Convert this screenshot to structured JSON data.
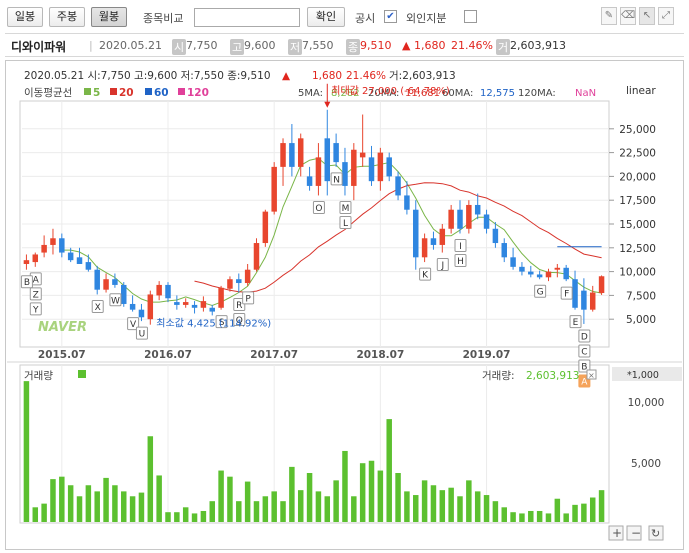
{
  "toolbar": {
    "tab_daily": "일봉",
    "tab_weekly": "주봉",
    "tab_monthly": "월봉",
    "compare_label": "종목비교",
    "compare_value": "",
    "confirm_button": "확인",
    "disclosure_label": "공시",
    "disclosure_checked": "✔",
    "foreign_label": "외인지분"
  },
  "stock": {
    "name": "디와이파워",
    "date": "2020.05.21",
    "open_tag": "시",
    "open": "7,750",
    "high_tag": "고",
    "high": "9,600",
    "low_tag": "저",
    "low": "7,550",
    "close_tag": "종",
    "close": "9,510",
    "change": "▲ 1,680",
    "change_pct": "21.46%",
    "volume_tag": "거",
    "volume": "2,603,913"
  },
  "chart_header": {
    "line": "2020.05.21 시:7,750 고:9,600 저:7,550 종:9,510",
    "up_arrow": "▲",
    "change": "1,680",
    "change_pct": "21.46%",
    "volume": "거:2,603,913"
  },
  "ma_legend": {
    "title": "이동평균선",
    "items": [
      "5",
      "20",
      "60",
      "120"
    ],
    "ma5_label": "5MA:",
    "ma5_value": "8,282",
    "ma20_label": "20MA:",
    "ma20_value": "11,681",
    "ma60_label": "60MA:",
    "ma60_value": "12,575",
    "ma120_label": "120MA:",
    "ma120_value": "NaN",
    "scale_mode": "linear"
  },
  "colors": {
    "up": "#e8462e",
    "down": "#2f86e0",
    "ma5": "#7ab648",
    "ma20": "#d8342c",
    "ma60": "#1f63c6",
    "ma120": "#e0409a",
    "volume": "#5cc02f"
  },
  "annotations": {
    "max_label": "최대값 27,000 (-64.78%)",
    "min_label": "최소값 4,425 (114.92%)"
  },
  "watermark": "NAVER",
  "volume_panel": {
    "title": "거래량",
    "readout_label": "거래량:",
    "readout_value": "2,603,913",
    "unit": "*1,000",
    "ticks": [
      "10,000",
      "5,000"
    ]
  },
  "chart_data": {
    "type": "candlestick",
    "interval": "monthly",
    "y_range": [
      2500,
      27500
    ],
    "y_ticks": [
      "25,000",
      "22,500",
      "20,000",
      "17,500",
      "15,000",
      "12,500",
      "10,000",
      "7,500",
      "5,000"
    ],
    "x_ticks": [
      "2015.07",
      "2016.07",
      "2017.07",
      "2018.07",
      "2019.07"
    ],
    "candles": [
      {
        "o": 10800,
        "h": 11800,
        "l": 10200,
        "c": 11200
      },
      {
        "o": 11000,
        "h": 12000,
        "l": 10500,
        "c": 11800
      },
      {
        "o": 12000,
        "h": 13800,
        "l": 11500,
        "c": 12800
      },
      {
        "o": 12800,
        "h": 14500,
        "l": 11800,
        "c": 13500
      },
      {
        "o": 13500,
        "h": 14000,
        "l": 11500,
        "c": 12000
      },
      {
        "o": 12000,
        "h": 12500,
        "l": 11000,
        "c": 11200
      },
      {
        "o": 11500,
        "h": 12500,
        "l": 10800,
        "c": 10800
      },
      {
        "o": 11000,
        "h": 11800,
        "l": 10000,
        "c": 10200
      },
      {
        "o": 10200,
        "h": 10600,
        "l": 7600,
        "c": 8100
      },
      {
        "o": 8100,
        "h": 9800,
        "l": 7800,
        "c": 9200
      },
      {
        "o": 9200,
        "h": 9800,
        "l": 8300,
        "c": 8600
      },
      {
        "o": 8600,
        "h": 8900,
        "l": 6300,
        "c": 6600
      },
      {
        "o": 6600,
        "h": 7500,
        "l": 5800,
        "c": 6000
      },
      {
        "o": 6000,
        "h": 6600,
        "l": 4800,
        "c": 5200
      },
      {
        "o": 5000,
        "h": 8000,
        "l": 4425,
        "c": 7600
      },
      {
        "o": 7500,
        "h": 9000,
        "l": 7000,
        "c": 8600
      },
      {
        "o": 8600,
        "h": 8900,
        "l": 6800,
        "c": 7200
      },
      {
        "o": 6800,
        "h": 7500,
        "l": 6000,
        "c": 6500
      },
      {
        "o": 6500,
        "h": 7200,
        "l": 6200,
        "c": 6800
      },
      {
        "o": 6500,
        "h": 6900,
        "l": 5600,
        "c": 6200
      },
      {
        "o": 6200,
        "h": 7400,
        "l": 5800,
        "c": 6900
      },
      {
        "o": 6200,
        "h": 6500,
        "l": 5400,
        "c": 5800
      },
      {
        "o": 6200,
        "h": 8500,
        "l": 6000,
        "c": 8300
      },
      {
        "o": 8200,
        "h": 9500,
        "l": 7900,
        "c": 9200
      },
      {
        "o": 9200,
        "h": 9800,
        "l": 7800,
        "c": 8800
      },
      {
        "o": 8800,
        "h": 10800,
        "l": 8500,
        "c": 10200
      },
      {
        "o": 10200,
        "h": 13500,
        "l": 10000,
        "c": 13000
      },
      {
        "o": 13000,
        "h": 16500,
        "l": 12600,
        "c": 16300
      },
      {
        "o": 16300,
        "h": 21500,
        "l": 16000,
        "c": 21000
      },
      {
        "o": 21000,
        "h": 24000,
        "l": 19000,
        "c": 23500
      },
      {
        "o": 23500,
        "h": 25500,
        "l": 20000,
        "c": 21000
      },
      {
        "o": 21000,
        "h": 24500,
        "l": 20000,
        "c": 24000
      },
      {
        "o": 20000,
        "h": 21000,
        "l": 18500,
        "c": 19000
      },
      {
        "o": 19000,
        "h": 23500,
        "l": 18000,
        "c": 22000
      },
      {
        "o": 24000,
        "h": 27000,
        "l": 18000,
        "c": 19500
      },
      {
        "o": 23500,
        "h": 24500,
        "l": 21000,
        "c": 21500
      },
      {
        "o": 21500,
        "h": 23000,
        "l": 18000,
        "c": 19000
      },
      {
        "o": 19000,
        "h": 23500,
        "l": 17500,
        "c": 22800
      },
      {
        "o": 22000,
        "h": 26500,
        "l": 21000,
        "c": 22500
      },
      {
        "o": 22000,
        "h": 23200,
        "l": 19000,
        "c": 19500
      },
      {
        "o": 19500,
        "h": 23000,
        "l": 18500,
        "c": 22500
      },
      {
        "o": 22000,
        "h": 22500,
        "l": 19500,
        "c": 20000
      },
      {
        "o": 20000,
        "h": 20500,
        "l": 17500,
        "c": 18000
      },
      {
        "o": 18000,
        "h": 19500,
        "l": 16000,
        "c": 16500
      },
      {
        "o": 16500,
        "h": 17500,
        "l": 10200,
        "c": 11500
      },
      {
        "o": 11500,
        "h": 14000,
        "l": 11000,
        "c": 13500
      },
      {
        "o": 13500,
        "h": 14200,
        "l": 12300,
        "c": 12800
      },
      {
        "o": 12800,
        "h": 15000,
        "l": 12000,
        "c": 14500
      },
      {
        "o": 14500,
        "h": 17000,
        "l": 14000,
        "c": 16500
      },
      {
        "o": 16500,
        "h": 17500,
        "l": 14000,
        "c": 14500
      },
      {
        "o": 14500,
        "h": 17500,
        "l": 14000,
        "c": 17000
      },
      {
        "o": 17000,
        "h": 18200,
        "l": 15500,
        "c": 16000
      },
      {
        "o": 16000,
        "h": 16500,
        "l": 14000,
        "c": 14500
      },
      {
        "o": 14500,
        "h": 15200,
        "l": 12500,
        "c": 13000
      },
      {
        "o": 13000,
        "h": 13500,
        "l": 11000,
        "c": 11500
      },
      {
        "o": 11500,
        "h": 12500,
        "l": 10200,
        "c": 10500
      },
      {
        "o": 10500,
        "h": 11000,
        "l": 9600,
        "c": 10000
      },
      {
        "o": 10000,
        "h": 10600,
        "l": 9400,
        "c": 9700
      },
      {
        "o": 9700,
        "h": 10100,
        "l": 9200,
        "c": 9400
      },
      {
        "o": 9400,
        "h": 10300,
        "l": 9000,
        "c": 10000
      },
      {
        "o": 10200,
        "h": 10800,
        "l": 9400,
        "c": 10400
      },
      {
        "o": 10400,
        "h": 10700,
        "l": 9000,
        "c": 9200
      },
      {
        "o": 9200,
        "h": 10100,
        "l": 6000,
        "c": 6200
      },
      {
        "o": 8000,
        "h": 9300,
        "l": 4500,
        "c": 6000
      },
      {
        "o": 6000,
        "h": 8500,
        "l": 5800,
        "c": 7800
      },
      {
        "o": 7750,
        "h": 9600,
        "l": 7550,
        "c": 9510
      }
    ],
    "volumes": [
      11500,
      1200,
      1500,
      3500,
      3700,
      3000,
      2100,
      3000,
      2500,
      3600,
      3000,
      2500,
      2100,
      2400,
      7000,
      3800,
      800,
      800,
      1200,
      700,
      900,
      1700,
      4200,
      3700,
      1700,
      3300,
      1700,
      2100,
      2500,
      1700,
      4500,
      2600,
      4000,
      2500,
      2100,
      3400,
      5800,
      2100,
      4800,
      5000,
      4200,
      8400,
      4000,
      2500,
      2200,
      3400,
      3000,
      2600,
      2800,
      2100,
      3400,
      2500,
      2200,
      1700,
      1200,
      800,
      700,
      900,
      900,
      700,
      1900,
      700,
      1400,
      1500,
      2000,
      2600
    ],
    "volume_ylim": [
      0,
      12000
    ],
    "event_labels": [
      {
        "text": "A",
        "i": 1
      },
      {
        "text": "B",
        "i": 0
      },
      {
        "text": "Z",
        "i": 1
      },
      {
        "text": "Y",
        "i": 1
      },
      {
        "text": "X",
        "i": 8
      },
      {
        "text": "W",
        "i": 10
      },
      {
        "text": "V",
        "i": 12
      },
      {
        "text": "U",
        "i": 13
      },
      {
        "text": "S",
        "i": 22
      },
      {
        "text": "R",
        "i": 24
      },
      {
        "text": "P",
        "i": 25
      },
      {
        "text": "Q",
        "i": 24
      },
      {
        "text": "O",
        "i": 33
      },
      {
        "text": "N",
        "i": 35
      },
      {
        "text": "M",
        "i": 36
      },
      {
        "text": "L",
        "i": 36
      },
      {
        "text": "K",
        "i": 45
      },
      {
        "text": "J",
        "i": 47
      },
      {
        "text": "I",
        "i": 49
      },
      {
        "text": "H",
        "i": 49
      },
      {
        "text": "G",
        "i": 58
      },
      {
        "text": "F",
        "i": 61
      },
      {
        "text": "E",
        "i": 62
      },
      {
        "text": "D",
        "i": 63
      },
      {
        "text": "C",
        "i": 63
      },
      {
        "text": "B",
        "i": 63
      },
      {
        "text": "A",
        "i": 63
      }
    ]
  }
}
